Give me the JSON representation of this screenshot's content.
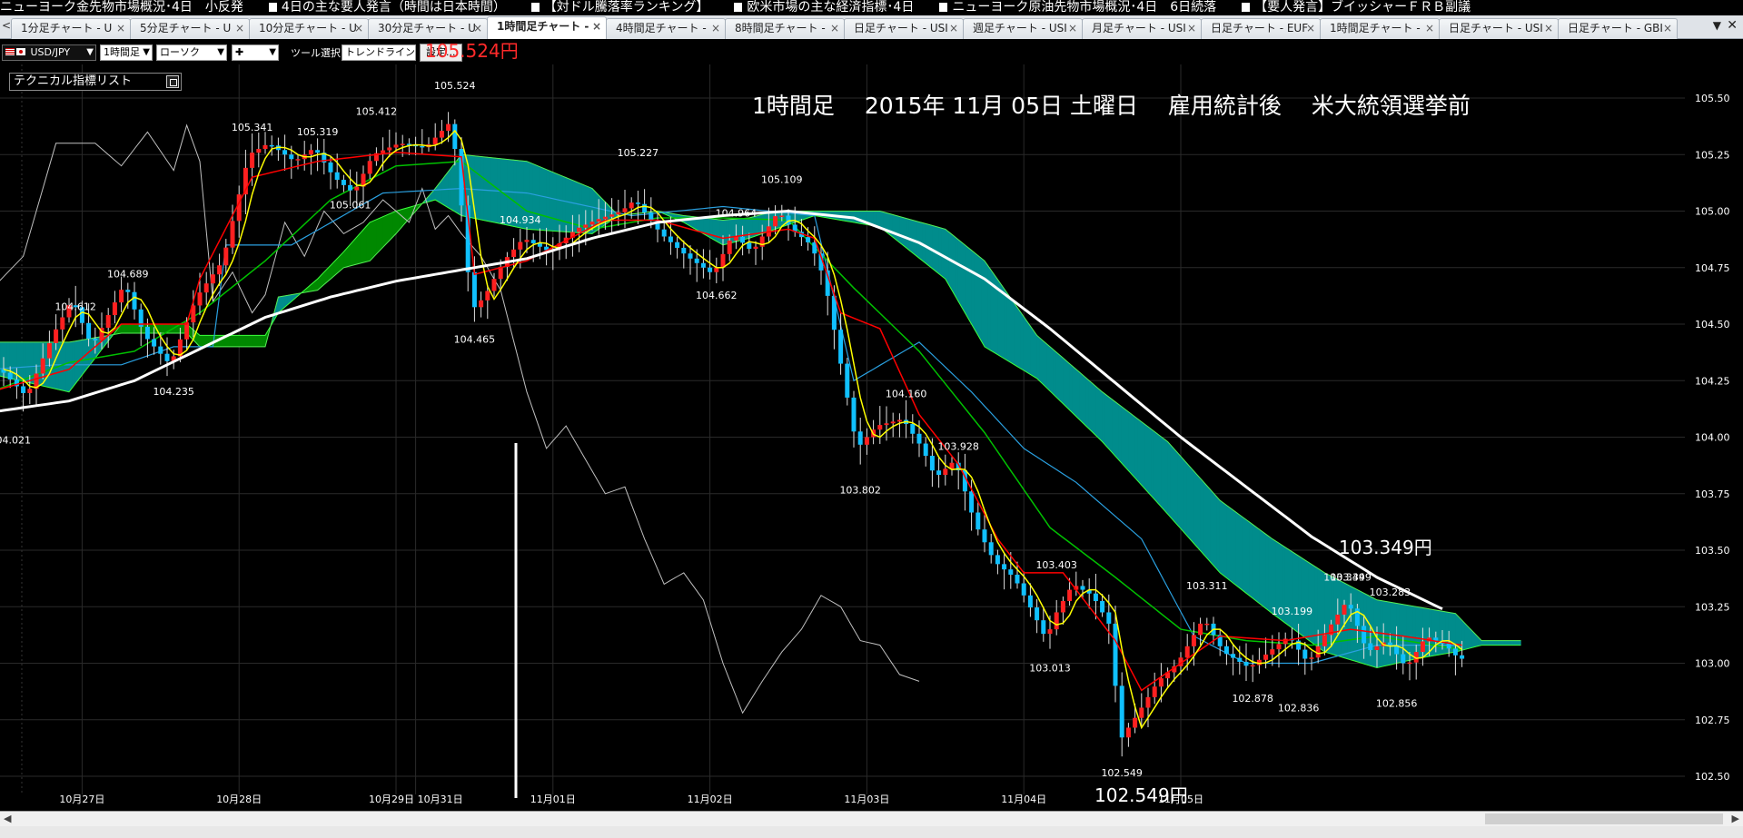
{
  "ticker": [
    "ニューヨーク金先物市場概況･4日　小反発",
    "4日の主な要人発言（時間は日本時間）",
    "【対ドル騰落率ランキング】",
    "欧米市場の主な経済指標･4日",
    "ニューヨーク原油先物市場概況･4日　6日続落",
    "【要人発言】ブイッシャーＦＲＢ副議"
  ],
  "tabs": [
    {
      "label": "1分足チャート - U"
    },
    {
      "label": "5分足チャート - U"
    },
    {
      "label": "10分足チャート - U"
    },
    {
      "label": "30分足チャート - U"
    },
    {
      "label": "1時間足チャート - ",
      "active": true
    },
    {
      "label": "4時間足チャート - "
    },
    {
      "label": "8時間足チャート - "
    },
    {
      "label": "日足チャート - USI"
    },
    {
      "label": "週足チャート - USI"
    },
    {
      "label": "月足チャート - USI"
    },
    {
      "label": "日足チャート - EUF"
    },
    {
      "label": "1時間足チャート - "
    },
    {
      "label": "日足チャート - USI"
    },
    {
      "label": "日足チャート - GBI"
    }
  ],
  "toolbar": {
    "pair": "USD/JPY",
    "timeframe": "1時間足",
    "chart_type": "ローソク",
    "tool_select": "ツール選択",
    "trendline": "トレンドライン",
    "settings": "設定..."
  },
  "indicator_list": "テクニカル指標リスト",
  "annotations": {
    "title": "1時間足　 2015年 11月 05日 土曜日　 雇用統計後　 米大統領選挙前",
    "high_price": "105.524円",
    "low_price": "102.549円",
    "cloud_price": "103.349円"
  },
  "colors": {
    "bull": "#ff2020",
    "bear": "#10c0ff",
    "ma_white": "#ffffff",
    "tenkan_yellow": "#ffff00",
    "kijun_red": "#ff0000",
    "ma_green": "#00c000",
    "blue_line": "#2aa0e0",
    "chikou_gray": "#c0c0c0",
    "kumo_bull": "#008800",
    "kumo_bear": "#008c8c"
  },
  "chart_data": {
    "type": "candlestick",
    "symbol": "USD/JPY",
    "ylim": [
      102.45,
      105.55
    ],
    "y_ticks": [
      "105.50",
      "105.25",
      "105.00",
      "104.75",
      "104.50",
      "104.25",
      "104.00",
      "103.75",
      "103.50",
      "103.25",
      "103.00",
      "102.75",
      "102.50"
    ],
    "x_ticks": [
      "10月27日",
      "10月28日",
      "10月29日",
      "10月31日",
      "11月01日",
      "11月02日",
      "11月03日",
      "11月04日",
      "11月05日"
    ],
    "price_labels": [
      {
        "t": "104.021",
        "x": 1,
        "y": 104.02
      },
      {
        "t": "104.612",
        "x": 11,
        "y": 104.61
      },
      {
        "t": "104.689",
        "x": 19,
        "y": 104.69
      },
      {
        "t": "104.235",
        "x": 26,
        "y": 104.235
      },
      {
        "t": "105.341",
        "x": 38,
        "y": 105.34
      },
      {
        "t": "105.319",
        "x": 48,
        "y": 105.32
      },
      {
        "t": "105.061",
        "x": 53,
        "y": 105.06
      },
      {
        "t": "105.412",
        "x": 57,
        "y": 105.41
      },
      {
        "t": "105.524",
        "x": 69,
        "y": 105.524
      },
      {
        "t": "104.465",
        "x": 72,
        "y": 104.465
      },
      {
        "t": "104.934",
        "x": 79,
        "y": 104.93
      },
      {
        "t": "105.227",
        "x": 97,
        "y": 105.227
      },
      {
        "t": "104.662",
        "x": 109,
        "y": 104.66
      },
      {
        "t": "104.964",
        "x": 112,
        "y": 104.96
      },
      {
        "t": "105.109",
        "x": 119,
        "y": 105.109
      },
      {
        "t": "103.802",
        "x": 131,
        "y": 103.8
      },
      {
        "t": "104.160",
        "x": 138,
        "y": 104.16
      },
      {
        "t": "103.928",
        "x": 146,
        "y": 103.928
      },
      {
        "t": "103.013",
        "x": 160,
        "y": 103.013
      },
      {
        "t": "103.403",
        "x": 161,
        "y": 103.403
      },
      {
        "t": "102.549",
        "x": 171,
        "y": 102.549
      },
      {
        "t": "103.311",
        "x": 184,
        "y": 103.311
      },
      {
        "t": "102.878",
        "x": 191,
        "y": 102.878
      },
      {
        "t": "103.199",
        "x": 197,
        "y": 103.199
      },
      {
        "t": "102.836",
        "x": 198,
        "y": 102.836
      },
      {
        "t": "103.349",
        "x": 205,
        "y": 103.349
      },
      {
        "t": "103.349",
        "x": 206,
        "y": 103.349
      },
      {
        "t": "103.283",
        "x": 212,
        "y": 103.283
      },
      {
        "t": "102.856",
        "x": 213,
        "y": 102.856
      }
    ],
    "price_keys": [
      [
        0,
        104.3
      ],
      [
        4,
        104.18
      ],
      [
        8,
        104.45
      ],
      [
        11,
        104.61
      ],
      [
        14,
        104.4
      ],
      [
        19,
        104.68
      ],
      [
        22,
        104.45
      ],
      [
        26,
        104.32
      ],
      [
        30,
        104.62
      ],
      [
        34,
        104.78
      ],
      [
        38,
        105.25
      ],
      [
        41,
        105.3
      ],
      [
        45,
        105.22
      ],
      [
        48,
        105.28
      ],
      [
        51,
        105.15
      ],
      [
        54,
        105.08
      ],
      [
        57,
        105.25
      ],
      [
        61,
        105.3
      ],
      [
        65,
        105.28
      ],
      [
        69,
        105.4
      ],
      [
        71,
        104.9
      ],
      [
        72,
        104.56
      ],
      [
        74,
        104.62
      ],
      [
        77,
        104.78
      ],
      [
        80,
        104.88
      ],
      [
        84,
        104.82
      ],
      [
        88,
        104.92
      ],
      [
        91,
        104.96
      ],
      [
        95,
        105.0
      ],
      [
        97,
        105.05
      ],
      [
        101,
        104.9
      ],
      [
        105,
        104.8
      ],
      [
        109,
        104.72
      ],
      [
        112,
        104.9
      ],
      [
        115,
        104.82
      ],
      [
        119,
        105.0
      ],
      [
        121,
        104.92
      ],
      [
        124,
        104.85
      ],
      [
        126,
        104.7
      ],
      [
        128,
        104.4
      ],
      [
        131,
        103.95
      ],
      [
        134,
        104.05
      ],
      [
        138,
        104.08
      ],
      [
        141,
        103.95
      ],
      [
        143,
        103.82
      ],
      [
        146,
        103.9
      ],
      [
        149,
        103.62
      ],
      [
        152,
        103.45
      ],
      [
        155,
        103.38
      ],
      [
        158,
        103.22
      ],
      [
        160,
        103.1
      ],
      [
        161,
        103.2
      ],
      [
        164,
        103.35
      ],
      [
        167,
        103.3
      ],
      [
        170,
        103.15
      ],
      [
        171,
        102.65
      ],
      [
        174,
        102.78
      ],
      [
        177,
        102.92
      ],
      [
        180,
        103.0
      ],
      [
        184,
        103.2
      ],
      [
        187,
        103.05
      ],
      [
        191,
        102.98
      ],
      [
        194,
        103.05
      ],
      [
        197,
        103.12
      ],
      [
        200,
        103.0
      ],
      [
        203,
        103.15
      ],
      [
        206,
        103.28
      ],
      [
        209,
        103.05
      ],
      [
        212,
        103.1
      ],
      [
        215,
        102.98
      ],
      [
        218,
        103.12
      ],
      [
        221,
        103.08
      ],
      [
        223,
        103.02
      ]
    ],
    "ma_white_keys": [
      [
        -2,
        104.11
      ],
      [
        10,
        104.16
      ],
      [
        20,
        104.25
      ],
      [
        30,
        104.39
      ],
      [
        40,
        104.53
      ],
      [
        50,
        104.62
      ],
      [
        60,
        104.69
      ],
      [
        70,
        104.74
      ],
      [
        80,
        104.79
      ],
      [
        90,
        104.88
      ],
      [
        100,
        104.95
      ],
      [
        110,
        104.98
      ],
      [
        120,
        105.0
      ],
      [
        130,
        104.97
      ],
      [
        140,
        104.86
      ],
      [
        150,
        104.7
      ],
      [
        160,
        104.48
      ],
      [
        170,
        104.24
      ],
      [
        180,
        104.0
      ],
      [
        190,
        103.78
      ],
      [
        200,
        103.56
      ],
      [
        210,
        103.38
      ],
      [
        220,
        103.24
      ]
    ],
    "kijun_keys": [
      [
        -2,
        104.2
      ],
      [
        10,
        104.3
      ],
      [
        18,
        104.5
      ],
      [
        28,
        104.5
      ],
      [
        30,
        104.7
      ],
      [
        38,
        105.15
      ],
      [
        48,
        105.22
      ],
      [
        60,
        105.26
      ],
      [
        70,
        105.24
      ],
      [
        72,
        104.72
      ],
      [
        80,
        104.78
      ],
      [
        92,
        104.96
      ],
      [
        100,
        104.96
      ],
      [
        110,
        104.88
      ],
      [
        120,
        104.92
      ],
      [
        124,
        104.88
      ],
      [
        128,
        104.55
      ],
      [
        134,
        104.48
      ],
      [
        140,
        104.1
      ],
      [
        146,
        103.88
      ],
      [
        152,
        103.55
      ],
      [
        156,
        103.4
      ],
      [
        162,
        103.4
      ],
      [
        170,
        103.1
      ],
      [
        174,
        102.88
      ],
      [
        180,
        103.0
      ],
      [
        186,
        103.12
      ],
      [
        196,
        103.1
      ],
      [
        206,
        103.15
      ],
      [
        214,
        103.12
      ],
      [
        223,
        103.08
      ]
    ],
    "ma_green_keys": [
      [
        -2,
        104.2
      ],
      [
        10,
        104.33
      ],
      [
        20,
        104.38
      ],
      [
        30,
        104.55
      ],
      [
        40,
        104.78
      ],
      [
        50,
        105.05
      ],
      [
        60,
        105.2
      ],
      [
        70,
        105.22
      ],
      [
        80,
        105.0
      ],
      [
        90,
        104.92
      ],
      [
        100,
        104.97
      ],
      [
        110,
        104.97
      ],
      [
        120,
        104.96
      ],
      [
        130,
        104.66
      ],
      [
        140,
        104.38
      ],
      [
        150,
        104.02
      ],
      [
        160,
        103.6
      ],
      [
        170,
        103.38
      ],
      [
        180,
        103.15
      ],
      [
        190,
        103.1
      ],
      [
        200,
        103.08
      ],
      [
        210,
        103.12
      ],
      [
        223,
        103.06
      ]
    ],
    "blue_keys": [
      [
        -2,
        104.3
      ],
      [
        8,
        104.32
      ],
      [
        18,
        104.32
      ],
      [
        26,
        104.4
      ],
      [
        32,
        104.4
      ],
      [
        34,
        104.85
      ],
      [
        44,
        104.85
      ],
      [
        58,
        105.08
      ],
      [
        70,
        105.1
      ],
      [
        80,
        105.08
      ],
      [
        96,
        104.98
      ],
      [
        110,
        105.02
      ],
      [
        124,
        104.98
      ],
      [
        130,
        104.25
      ],
      [
        140,
        104.42
      ],
      [
        148,
        104.2
      ],
      [
        156,
        103.95
      ],
      [
        164,
        103.8
      ],
      [
        174,
        103.55
      ],
      [
        182,
        103.12
      ],
      [
        190,
        103.0
      ],
      [
        200,
        103.0
      ],
      [
        210,
        103.08
      ],
      [
        223,
        103.08
      ]
    ],
    "chikou_keys": [
      [
        -2,
        104.65
      ],
      [
        3,
        104.8
      ],
      [
        8,
        105.3
      ],
      [
        14,
        105.3
      ],
      [
        18,
        105.2
      ],
      [
        22,
        105.35
      ],
      [
        26,
        105.18
      ],
      [
        28,
        105.38
      ],
      [
        30,
        105.22
      ],
      [
        32,
        104.6
      ],
      [
        35,
        104.73
      ],
      [
        38,
        104.55
      ],
      [
        40,
        104.63
      ],
      [
        43,
        104.95
      ],
      [
        46,
        104.8
      ],
      [
        49,
        105.0
      ],
      [
        52,
        104.9
      ],
      [
        55,
        104.95
      ],
      [
        58,
        105.05
      ],
      [
        60,
        105.0
      ],
      [
        62,
        104.95
      ],
      [
        64,
        105.1
      ],
      [
        66,
        104.92
      ],
      [
        68,
        104.98
      ],
      [
        70,
        104.9
      ],
      [
        73,
        104.8
      ],
      [
        76,
        104.65
      ],
      [
        80,
        104.2
      ],
      [
        83,
        103.95
      ],
      [
        86,
        104.05
      ],
      [
        89,
        103.9
      ],
      [
        92,
        103.75
      ],
      [
        95,
        103.78
      ],
      [
        98,
        103.55
      ],
      [
        101,
        103.35
      ],
      [
        104,
        103.4
      ],
      [
        107,
        103.28
      ],
      [
        110,
        103.0
      ],
      [
        113,
        102.78
      ],
      [
        116,
        102.92
      ],
      [
        119,
        103.05
      ],
      [
        122,
        103.15
      ],
      [
        125,
        103.3
      ],
      [
        128,
        103.25
      ],
      [
        131,
        103.1
      ],
      [
        134,
        103.08
      ],
      [
        137,
        102.95
      ],
      [
        140,
        102.92
      ]
    ],
    "span_a_keys": [
      [
        -2,
        104.28
      ],
      [
        10,
        104.2
      ],
      [
        18,
        104.5
      ],
      [
        28,
        104.5
      ],
      [
        30,
        104.45
      ],
      [
        40,
        104.45
      ],
      [
        42,
        104.55
      ],
      [
        48,
        104.7
      ],
      [
        52,
        104.82
      ],
      [
        56,
        104.95
      ],
      [
        60,
        105.0
      ],
      [
        66,
        105.05
      ],
      [
        70,
        104.98
      ],
      [
        80,
        104.92
      ],
      [
        90,
        104.9
      ],
      [
        94,
        104.98
      ],
      [
        100,
        105.0
      ],
      [
        104,
        104.95
      ],
      [
        110,
        104.85
      ],
      [
        114,
        104.88
      ],
      [
        118,
        104.92
      ],
      [
        124,
        104.98
      ],
      [
        134,
        104.93
      ],
      [
        144,
        104.7
      ],
      [
        150,
        104.4
      ],
      [
        158,
        104.26
      ],
      [
        168,
        103.98
      ],
      [
        178,
        103.66
      ],
      [
        186,
        103.4
      ],
      [
        194,
        103.22
      ],
      [
        202,
        103.05
      ],
      [
        210,
        102.98
      ],
      [
        216,
        103.02
      ],
      [
        222,
        103.05
      ],
      [
        226,
        103.08
      ],
      [
        232,
        103.08
      ]
    ],
    "span_b_keys": [
      [
        -2,
        104.42
      ],
      [
        10,
        104.42
      ],
      [
        18,
        104.46
      ],
      [
        28,
        104.46
      ],
      [
        30,
        104.4
      ],
      [
        40,
        104.4
      ],
      [
        42,
        104.62
      ],
      [
        48,
        104.65
      ],
      [
        52,
        104.75
      ],
      [
        56,
        104.78
      ],
      [
        60,
        104.9
      ],
      [
        66,
        105.1
      ],
      [
        70,
        105.25
      ],
      [
        80,
        105.22
      ],
      [
        90,
        105.1
      ],
      [
        94,
        104.98
      ],
      [
        100,
        105.0
      ],
      [
        104,
        104.98
      ],
      [
        110,
        104.96
      ],
      [
        114,
        104.97
      ],
      [
        118,
        105.0
      ],
      [
        124,
        105.0
      ],
      [
        134,
        105.0
      ],
      [
        144,
        104.92
      ],
      [
        150,
        104.78
      ],
      [
        158,
        104.45
      ],
      [
        168,
        104.2
      ],
      [
        178,
        103.98
      ],
      [
        186,
        103.72
      ],
      [
        194,
        103.55
      ],
      [
        202,
        103.4
      ],
      [
        210,
        103.28
      ],
      [
        216,
        103.25
      ],
      [
        222,
        103.22
      ],
      [
        226,
        103.1
      ],
      [
        232,
        103.1
      ]
    ]
  }
}
